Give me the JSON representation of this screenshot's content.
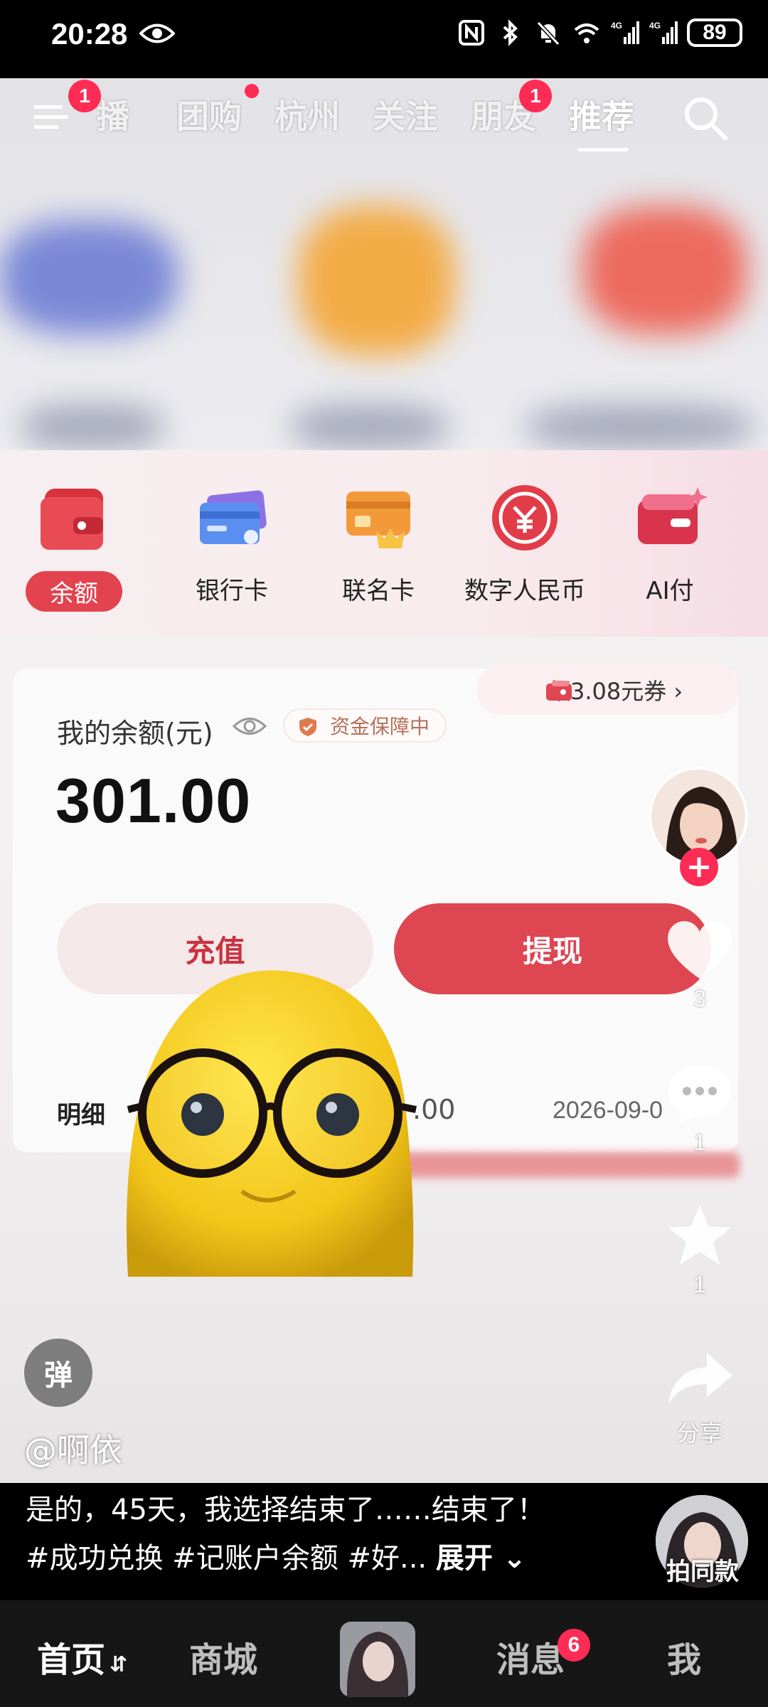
{
  "status": {
    "time": "20:28",
    "battery": "89",
    "network": "4G"
  },
  "top_tabs": {
    "menu_badge": "1",
    "items": [
      "播",
      "团购",
      "杭州",
      "关注",
      "朋友",
      "推荐"
    ],
    "friends_badge": "1",
    "active": "推荐"
  },
  "wallet": {
    "options": [
      "余额",
      "银行卡",
      "联名卡",
      "数字人民币",
      "AI付"
    ],
    "coupon": "领3.08元券 ›",
    "balance_label": "我的余额(元)",
    "security": "资金保障中",
    "balance": "301.00",
    "recharge": "充值",
    "withdraw": "提现",
    "detail_label": "明细",
    "detail_amount": ".00",
    "detail_date": "2026-09-0"
  },
  "sidebar": {
    "likes": "3",
    "comments": "1",
    "favorites": "1",
    "share": "分享"
  },
  "danmu": "弹",
  "author": "@啊依",
  "caption": {
    "line1": "是的，45天，我选择结束了……结束了！",
    "line2": "#成功兑换 #记账户余额 #好...",
    "expand": "展开",
    "same_style": "拍同款"
  },
  "bottom_nav": {
    "home": "首页",
    "mall": "商城",
    "messages": "消息",
    "messages_badge": "6",
    "me": "我"
  },
  "colors": {
    "accent": "#fe2c55",
    "wallet_red": "#de4652",
    "nav_bg": "#161616"
  }
}
